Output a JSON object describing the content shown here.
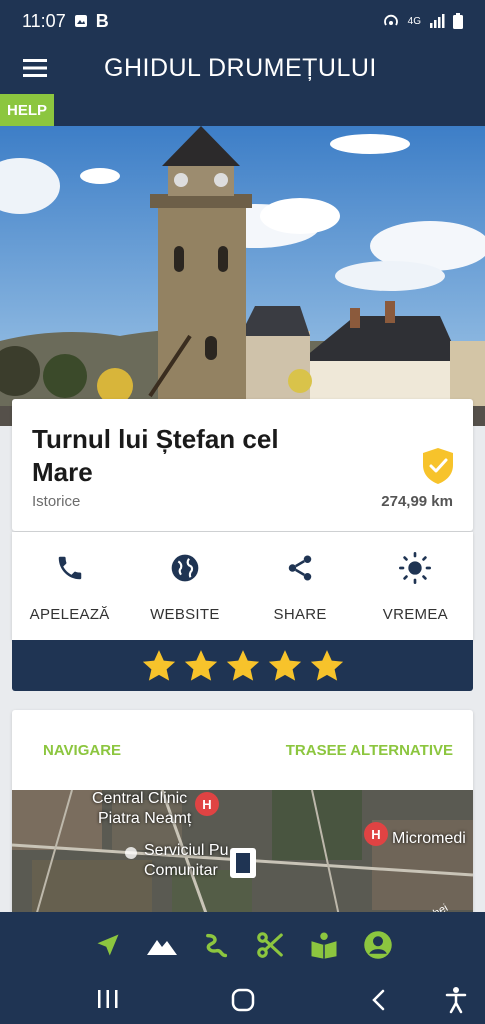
{
  "status": {
    "time": "11:07",
    "b_letter": "B",
    "network": "4G"
  },
  "app": {
    "title": "GHIDUL DRUMEȚULUI",
    "help_label": "HELP"
  },
  "place": {
    "name": "Turnul lui Ștefan cel Mare",
    "category": "Istorice",
    "distance": "274,99 km"
  },
  "actions": [
    {
      "label": "APELEAZĂ",
      "icon": "phone-icon"
    },
    {
      "label": "WEBSITE",
      "icon": "globe-icon"
    },
    {
      "label": "SHARE",
      "icon": "share-icon"
    },
    {
      "label": "VREMEA",
      "icon": "sun-icon"
    }
  ],
  "rating": {
    "stars": 5,
    "max": 5
  },
  "navigation": {
    "navigare": "NAVIGARE",
    "trasee": "TRASEE ALTERNATIVE"
  },
  "map": {
    "labels": [
      "Central Clinic",
      "Piatra Neamț",
      "Serviciul Pu",
      "Comunitar",
      "Micromedi",
      "Orhei"
    ]
  },
  "tabs": [
    "navigation-arrow-icon",
    "mountain-icon",
    "trail-icon",
    "tools-icon",
    "book-icon",
    "profile-icon"
  ],
  "colors": {
    "navy": "#1f3453",
    "green": "#8cc63f",
    "gold": "#f7c32b"
  }
}
